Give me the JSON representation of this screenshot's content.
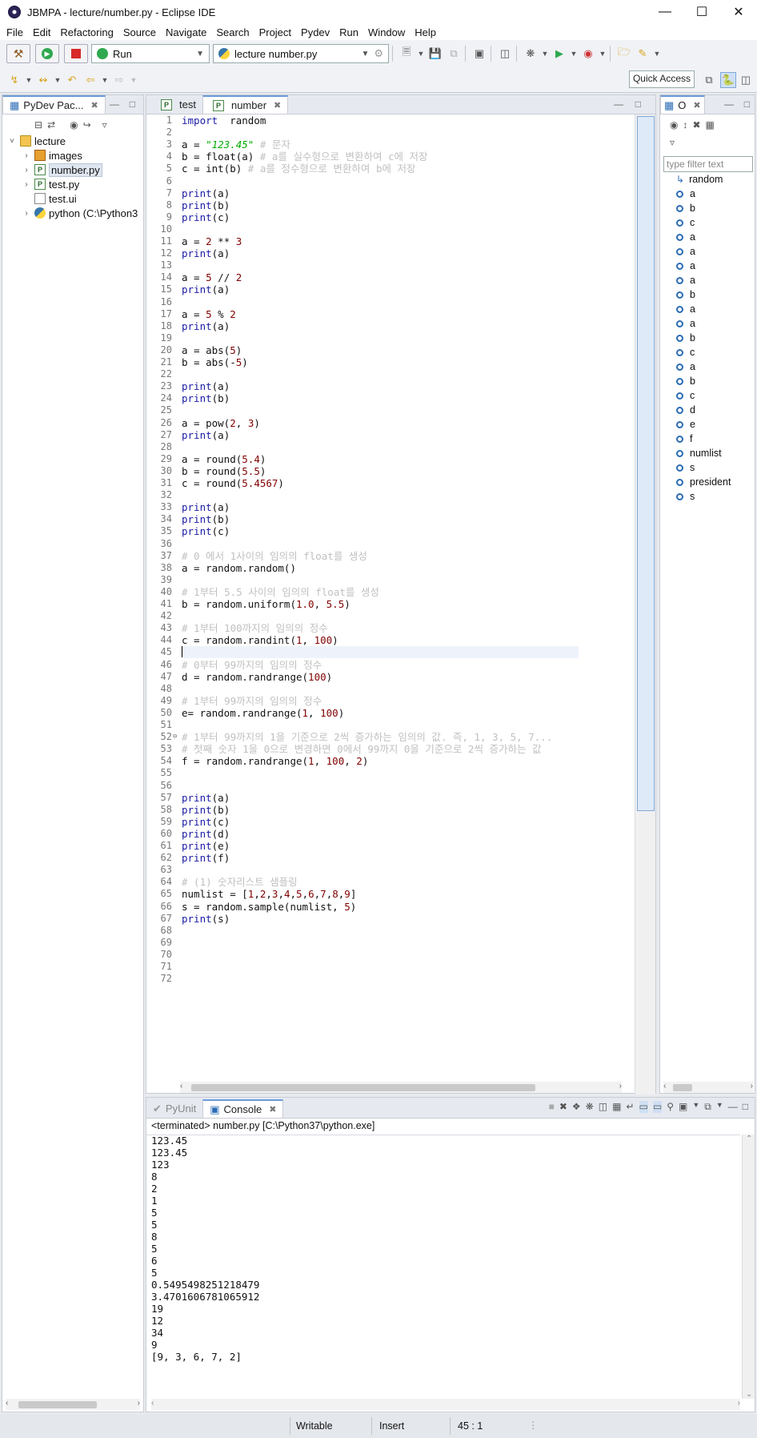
{
  "window": {
    "title": "JBMPA - lecture/number.py - Eclipse IDE"
  },
  "menu": [
    "File",
    "Edit",
    "Refactoring",
    "Source",
    "Navigate",
    "Search",
    "Project",
    "Pydev",
    "Run",
    "Window",
    "Help"
  ],
  "toolbar": {
    "run_combo": "Run",
    "config_combo": "lecture number.py",
    "quick_access": "Quick Access"
  },
  "explorer": {
    "tab_label": "PyDev Pac...",
    "tree": [
      {
        "label": "lecture",
        "level": 0,
        "expanded": true,
        "icon": "project-folder-icon"
      },
      {
        "label": "images",
        "level": 1,
        "expanded": false,
        "icon": "image-folder-icon"
      },
      {
        "label": "number.py",
        "level": 1,
        "expanded": false,
        "icon": "python-file-icon",
        "selected": true
      },
      {
        "label": "test.py",
        "level": 1,
        "expanded": false,
        "icon": "python-file-icon"
      },
      {
        "label": "test.ui",
        "level": 1,
        "expanded": null,
        "icon": "ui-file-icon"
      },
      {
        "label": "python  (C:\\Python3",
        "level": 1,
        "expanded": false,
        "icon": "python-interpreter-icon"
      }
    ]
  },
  "editor": {
    "tabs": [
      {
        "label": "test",
        "active": false
      },
      {
        "label": "number",
        "active": true
      }
    ],
    "cursor_line": 45,
    "lines": [
      [
        [
          "kw",
          "import"
        ],
        [
          "",
          "  random"
        ]
      ],
      [],
      [
        [
          "",
          "a = "
        ],
        [
          "str",
          "\"123.45\""
        ],
        [
          "cmt",
          " # 문자"
        ]
      ],
      [
        [
          "",
          "b = float(a) "
        ],
        [
          "cmt",
          "# a를 실수형으로 변환하여 c에 저장"
        ]
      ],
      [
        [
          "",
          "c = int(b) "
        ],
        [
          "cmt",
          "# a를 정수형으로 변환하여 b에 저장"
        ]
      ],
      [],
      [
        [
          "kw",
          "print"
        ],
        [
          "",
          "(a)"
        ]
      ],
      [
        [
          "kw",
          "print"
        ],
        [
          "",
          "(b)"
        ]
      ],
      [
        [
          "kw",
          "print"
        ],
        [
          "",
          "(c)"
        ]
      ],
      [],
      [
        [
          "",
          "a = "
        ],
        [
          "num",
          "2"
        ],
        [
          "",
          " ** "
        ],
        [
          "num",
          "3"
        ]
      ],
      [
        [
          "kw",
          "print"
        ],
        [
          "",
          "(a)"
        ]
      ],
      [],
      [
        [
          "",
          "a = "
        ],
        [
          "num",
          "5"
        ],
        [
          "",
          " // "
        ],
        [
          "num",
          "2"
        ]
      ],
      [
        [
          "kw",
          "print"
        ],
        [
          "",
          "(a)"
        ]
      ],
      [],
      [
        [
          "",
          "a = "
        ],
        [
          "num",
          "5"
        ],
        [
          "",
          " % "
        ],
        [
          "num",
          "2"
        ]
      ],
      [
        [
          "kw",
          "print"
        ],
        [
          "",
          "(a)"
        ]
      ],
      [],
      [
        [
          "",
          "a = abs("
        ],
        [
          "num",
          "5"
        ],
        [
          "",
          ")"
        ]
      ],
      [
        [
          "",
          "b = abs(-"
        ],
        [
          "num",
          "5"
        ],
        [
          "",
          ")"
        ]
      ],
      [],
      [
        [
          "kw",
          "print"
        ],
        [
          "",
          "(a)"
        ]
      ],
      [
        [
          "kw",
          "print"
        ],
        [
          "",
          "(b)"
        ]
      ],
      [],
      [
        [
          "",
          "a = pow("
        ],
        [
          "num",
          "2"
        ],
        [
          "",
          ", "
        ],
        [
          "num",
          "3"
        ],
        [
          "",
          ")"
        ]
      ],
      [
        [
          "kw",
          "print"
        ],
        [
          "",
          "(a)"
        ]
      ],
      [],
      [
        [
          "",
          "a = round("
        ],
        [
          "num",
          "5.4"
        ],
        [
          "",
          ")"
        ]
      ],
      [
        [
          "",
          "b = round("
        ],
        [
          "num",
          "5.5"
        ],
        [
          "",
          ")"
        ]
      ],
      [
        [
          "",
          "c = round("
        ],
        [
          "num",
          "5.4567"
        ],
        [
          "",
          ")"
        ]
      ],
      [],
      [
        [
          "kw",
          "print"
        ],
        [
          "",
          "(a)"
        ]
      ],
      [
        [
          "kw",
          "print"
        ],
        [
          "",
          "(b)"
        ]
      ],
      [
        [
          "kw",
          "print"
        ],
        [
          "",
          "(c)"
        ]
      ],
      [],
      [
        [
          "cmt",
          "# 0 에서 1사이의 임의의 float를 생성"
        ]
      ],
      [
        [
          "",
          "a = random.random()"
        ]
      ],
      [],
      [
        [
          "cmt",
          "# 1부터 5.5 사이의 임의의 float를 생성"
        ]
      ],
      [
        [
          "",
          "b = random.uniform("
        ],
        [
          "num",
          "1.0"
        ],
        [
          "",
          ", "
        ],
        [
          "num",
          "5.5"
        ],
        [
          "",
          ")"
        ]
      ],
      [],
      [
        [
          "cmt",
          "# 1부터 100까지의 임의의 정수"
        ]
      ],
      [
        [
          "",
          "c = random.randint("
        ],
        [
          "num",
          "1"
        ],
        [
          "",
          ", "
        ],
        [
          "num",
          "100"
        ],
        [
          "",
          ")"
        ]
      ],
      [],
      [
        [
          "cmt",
          "# 0부터 99까지의 임의의 정수"
        ]
      ],
      [
        [
          "",
          "d = random.randrange("
        ],
        [
          "num",
          "100"
        ],
        [
          "",
          ")"
        ]
      ],
      [],
      [
        [
          "cmt",
          "# 1부터 99까지의 임의의 정수"
        ]
      ],
      [
        [
          "",
          "e= random.randrange("
        ],
        [
          "num",
          "1"
        ],
        [
          "",
          ", "
        ],
        [
          "num",
          "100"
        ],
        [
          "",
          ")"
        ]
      ],
      [],
      [
        [
          "cmt",
          "# 1부터 99까지의 1을 기준으로 2씩 증가하는 임의의 값. 즉, 1, 3, 5, 7..."
        ]
      ],
      [
        [
          "cmt",
          "# 첫째 숫자 1을 0으로 변경하면 0에서 99까지 0을 기준으로 2씩 증가하는 값"
        ]
      ],
      [
        [
          "",
          "f = random.randrange("
        ],
        [
          "num",
          "1"
        ],
        [
          "",
          ", "
        ],
        [
          "num",
          "100"
        ],
        [
          "",
          ", "
        ],
        [
          "num",
          "2"
        ],
        [
          "",
          ")"
        ]
      ],
      [],
      [],
      [
        [
          "kw",
          "print"
        ],
        [
          "",
          "(a)"
        ]
      ],
      [
        [
          "kw",
          "print"
        ],
        [
          "",
          "(b)"
        ]
      ],
      [
        [
          "kw",
          "print"
        ],
        [
          "",
          "(c)"
        ]
      ],
      [
        [
          "kw",
          "print"
        ],
        [
          "",
          "(d)"
        ]
      ],
      [
        [
          "kw",
          "print"
        ],
        [
          "",
          "(e)"
        ]
      ],
      [
        [
          "kw",
          "print"
        ],
        [
          "",
          "(f)"
        ]
      ],
      [],
      [
        [
          "cmt",
          "# (1) 숫자리스트 샘플링"
        ]
      ],
      [
        [
          "",
          "numlist = ["
        ],
        [
          "num",
          "1"
        ],
        [
          "",
          ","
        ],
        [
          "num",
          "2"
        ],
        [
          "",
          ","
        ],
        [
          "num",
          "3"
        ],
        [
          "",
          ","
        ],
        [
          "num",
          "4"
        ],
        [
          "",
          ","
        ],
        [
          "num",
          "5"
        ],
        [
          "",
          ","
        ],
        [
          "num",
          "6"
        ],
        [
          "",
          ","
        ],
        [
          "num",
          "7"
        ],
        [
          "",
          ","
        ],
        [
          "num",
          "8"
        ],
        [
          "",
          ","
        ],
        [
          "num",
          "9"
        ],
        [
          "",
          "]"
        ]
      ],
      [
        [
          "",
          "s = random.sample(numlist, "
        ],
        [
          "num",
          "5"
        ],
        [
          "",
          ")"
        ]
      ],
      [
        [
          "kw",
          "print"
        ],
        [
          "",
          "(s)"
        ]
      ],
      [],
      [],
      [],
      [],
      []
    ]
  },
  "outline": {
    "tab_label": "O",
    "filter_placeholder": "type filter text",
    "items": [
      "random",
      "a",
      "b",
      "c",
      "a",
      "a",
      "a",
      "a",
      "b",
      "a",
      "a",
      "b",
      "c",
      "a",
      "b",
      "c",
      "d",
      "e",
      "f",
      "numlist",
      "s",
      "president",
      "s"
    ]
  },
  "console": {
    "tabs": [
      {
        "label": "Console",
        "active": true
      },
      {
        "label": "PyUnit",
        "active": false
      }
    ],
    "status": "<terminated> number.py [C:\\Python37\\python.exe]",
    "output": [
      "123.45",
      "123.45",
      "123",
      "8",
      "2",
      "1",
      "5",
      "5",
      "8",
      "5",
      "6",
      "5",
      "0.5495498251218479",
      "3.4701606781065912",
      "19",
      "12",
      "34",
      "9",
      "[9, 3, 6, 7, 2]"
    ]
  },
  "statusbar": {
    "writable": "Writable",
    "mode": "Insert",
    "position": "45 : 1"
  }
}
